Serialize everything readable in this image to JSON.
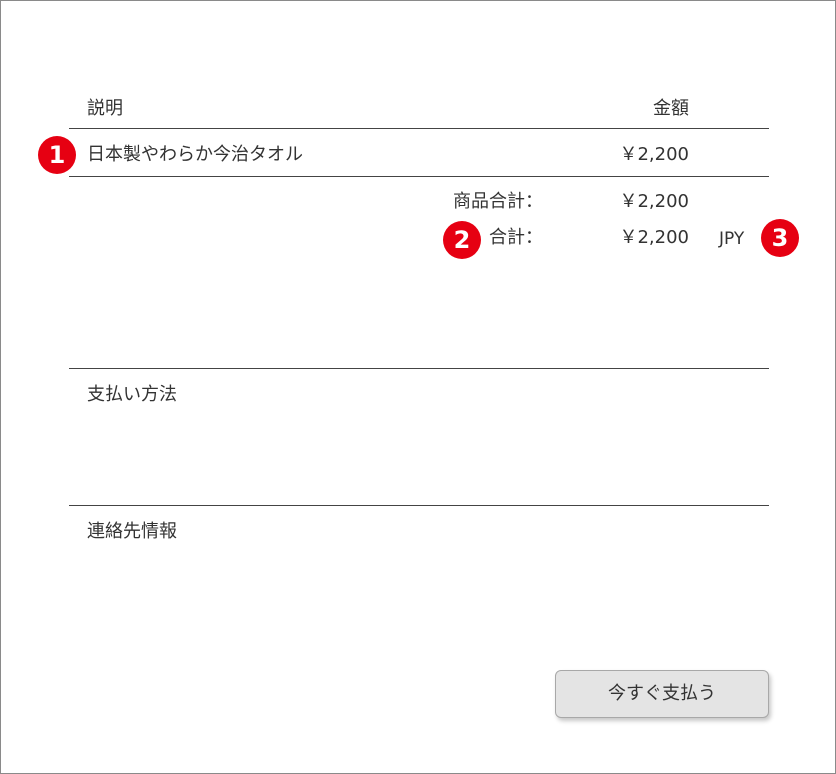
{
  "table": {
    "col_description": "説明",
    "col_amount": "金額",
    "items": [
      {
        "name": "日本製やわらか今治タオル",
        "amount": "￥2,200"
      }
    ]
  },
  "summary": {
    "subtotal_label": "商品合計：",
    "subtotal_value": "￥2,200",
    "total_label": "合計：",
    "total_value": "￥2,200",
    "currency": "JPY"
  },
  "sections": {
    "payment_method": "支払い方法",
    "contact_info": "連絡先情報"
  },
  "pay_button_label": "今すぐ支払う",
  "annotations": [
    "1",
    "2",
    "3"
  ],
  "colors": {
    "badge": "#e60012",
    "button_bg": "#e4e4e4",
    "rule": "#444444"
  }
}
